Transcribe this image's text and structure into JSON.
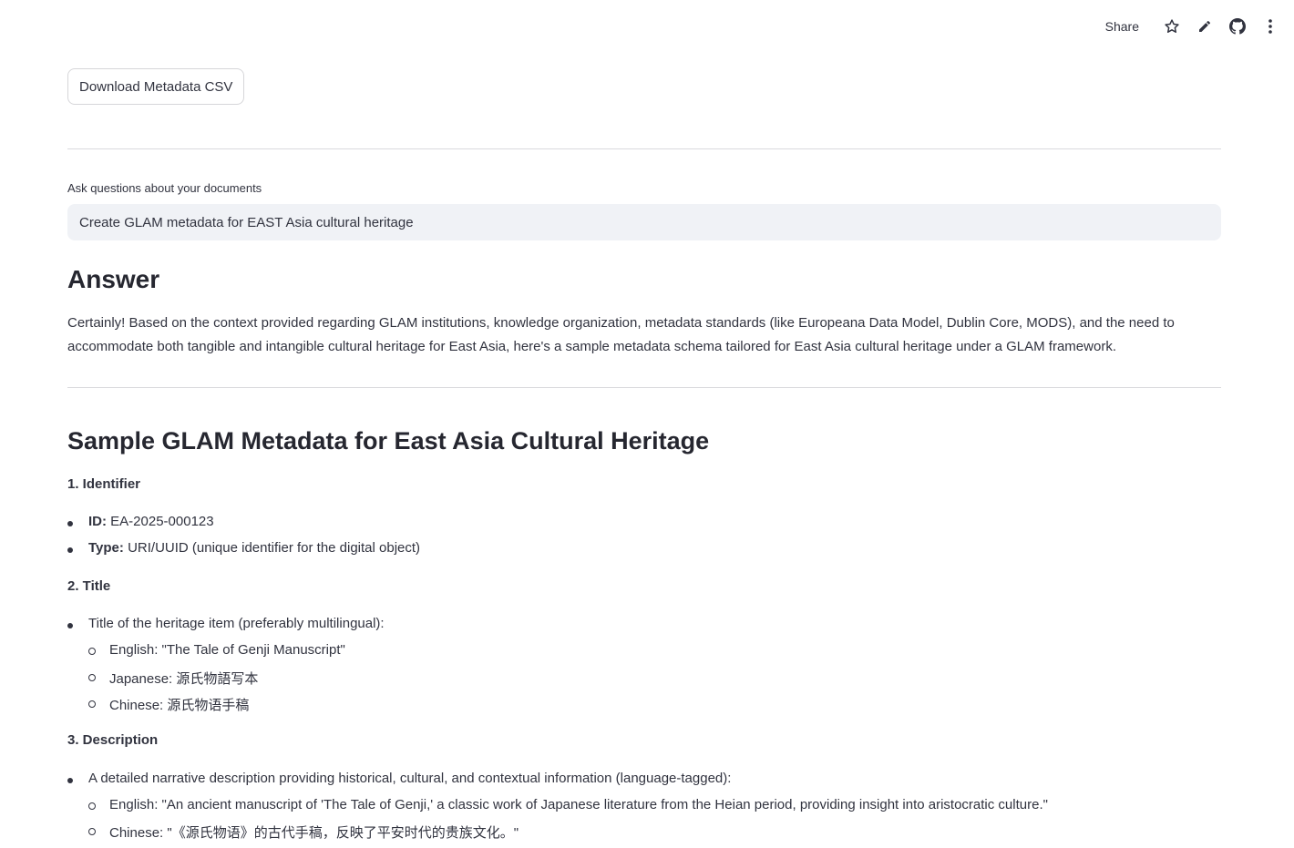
{
  "toolbar": {
    "share_label": "Share",
    "icons": [
      "star-icon",
      "pencil-icon",
      "github-icon",
      "more-vertical-icon"
    ]
  },
  "download_button": {
    "label": "Download Metadata CSV"
  },
  "query": {
    "label": "Ask questions about your documents",
    "value": "Create GLAM metadata for EAST Asia cultural heritage"
  },
  "answer": {
    "heading": "Answer",
    "intro": "Certainly! Based on the context provided regarding GLAM institutions, knowledge organization, metadata standards (like Europeana Data Model, Dublin Core, MODS), and the need to accommodate both tangible and intangible cultural heritage for East Asia, here's a sample metadata schema tailored for East Asia cultural heritage under a GLAM framework.",
    "sample_heading": "Sample GLAM Metadata for East Asia Cultural Heritage",
    "sections": {
      "identifier": {
        "title": "1. Identifier",
        "id_key": "ID:",
        "id_value": " EA-2025-000123",
        "type_key": "Type:",
        "type_value": " URI/UUID (unique identifier for the digital object)"
      },
      "title": {
        "title": "2. Title",
        "item": "Title of the heritage item (preferably multilingual):",
        "english": "English: \"The Tale of Genji Manuscript\"",
        "japanese": "Japanese: 源氏物語写本",
        "chinese": "Chinese: 源氏物语手稿"
      },
      "description": {
        "title": "3. Description",
        "item": "A detailed narrative description providing historical, cultural, and contextual information (language-tagged):",
        "english": "English: \"An ancient manuscript of 'The Tale of Genji,' a classic work of Japanese literature from the Heian period, providing insight into aristocratic culture.\"",
        "chinese": "Chinese: \"《源氏物语》的古代手稿，反映了平安时代的贵族文化。\""
      }
    }
  }
}
